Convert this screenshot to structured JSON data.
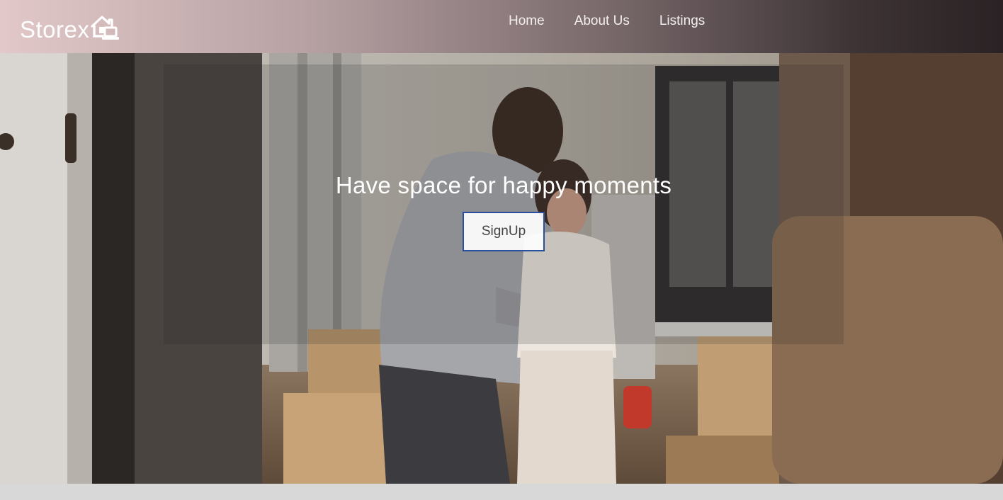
{
  "nav": {
    "brand": "Storex",
    "brand_icon": "house-laptop-icon",
    "links": [
      {
        "label": "Home"
      },
      {
        "label": "About Us"
      },
      {
        "label": "Listings"
      }
    ]
  },
  "hero": {
    "title": "Have space for happy moments",
    "cta_label": "SignUp",
    "background_image": "couple-moving-into-new-home-photo"
  },
  "colors": {
    "nav_gradient_start": "#e2c8c8",
    "nav_gradient_end": "#2a2224",
    "cta_border": "#2a4f9c",
    "footer_bg": "#d8d8d8"
  }
}
